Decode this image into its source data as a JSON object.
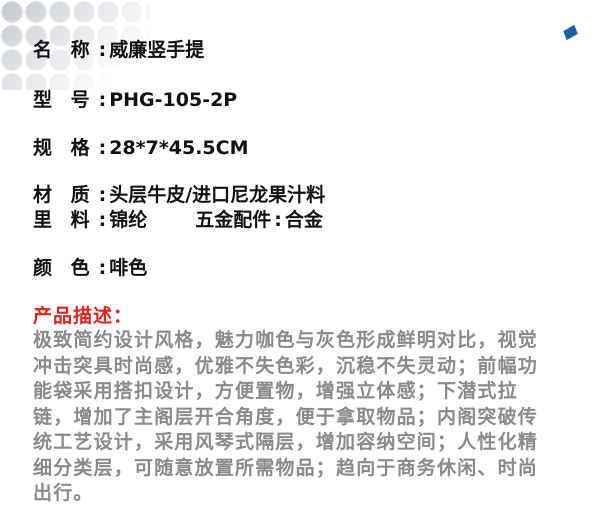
{
  "specs": [
    {
      "label": "名 称",
      "value": "威廉竖手提"
    },
    {
      "label": "型 号",
      "value": "PHG-105-2P"
    },
    {
      "label": "规 格",
      "value": "28*7*45.5CM"
    },
    {
      "label": "材 质",
      "value": "头层牛皮/进口尼龙果汁料"
    },
    {
      "label": "里 料",
      "value": "锦纶",
      "extra_label": "五金配件",
      "extra_value": "合金"
    },
    {
      "label": "颜 色",
      "value": "啡色"
    }
  ],
  "separator": ":",
  "description": {
    "title": "产品描述：",
    "text": "极致简约设计风格，魅力咖色与灰色形成鲜明对比，视觉冲击突具时尚感，优雅不失色彩，沉稳不失灵动；前幅功能袋采用搭扣设计，方便置物，增强立体感；下潜式拉链，增加了主阁层开合角度，便于拿取物品；内阁突破传统工艺设计，采用风琴式隔层，增加容纳空间；人性化精细分类层，可随意放置所需物品；趋向于商务休闲、时尚出行。"
  },
  "colors": {
    "label_text": "#111111",
    "title_red": "#e32219",
    "body_gray": "#8a8a8a",
    "accent_blue": "#1d5fa8"
  }
}
